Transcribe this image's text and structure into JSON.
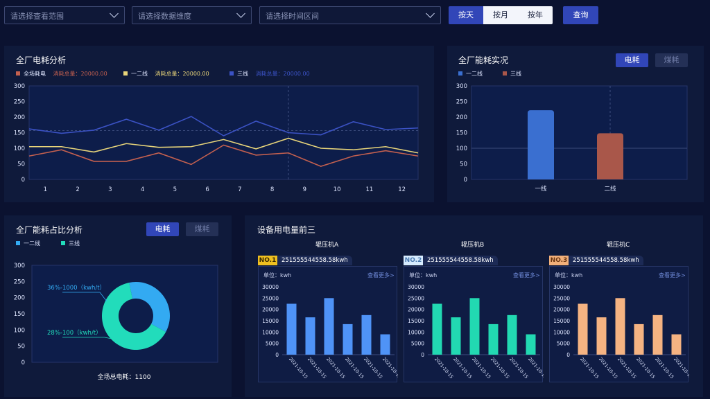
{
  "filters": {
    "scope_placeholder": "请选择查看范围",
    "dimension_placeholder": "请选择数据维度",
    "time_placeholder": "请选择时间区间",
    "period_buttons": [
      "按天",
      "按月",
      "按年"
    ],
    "query_label": "查询"
  },
  "toggles": {
    "power": "电耗",
    "coal": "煤耗"
  },
  "power_analysis": {
    "title": "全厂电耗分析",
    "legend": [
      {
        "name": "全场耗电",
        "total_label": "消耗总量：20000.00",
        "color": "#c4604f"
      },
      {
        "name": "一二线",
        "total_label": "消耗总量：20000.00",
        "color": "#e8d57a"
      },
      {
        "name": "三线",
        "total_label": "消耗总量：20000.00",
        "color": "#3b52c4"
      }
    ]
  },
  "energy_status": {
    "title": "全厂能耗实况",
    "legend": [
      {
        "name": "一二线",
        "color": "#3a6fd0"
      },
      {
        "name": "三线",
        "color": "#a9574a"
      }
    ]
  },
  "ratio_analysis": {
    "title": "全厂能耗占比分析",
    "legend": [
      {
        "name": "一二线",
        "color": "#33aaf2"
      },
      {
        "name": "三线",
        "color": "#22dcbb"
      }
    ],
    "total_label": "全场总电耗：1100"
  },
  "top_devices": {
    "title": "设备用电量前三",
    "unit_label": "单位：kwh",
    "more_label": "查看更多>",
    "devices": [
      {
        "name": "辊压机A",
        "rank": "NO.1",
        "serial": "251555544558.58kwh",
        "rank_bg": "#f0c020",
        "rank_color": "#3a2a00",
        "bar_color": "#4f93f7"
      },
      {
        "name": "辊压机B",
        "rank": "NO.2",
        "serial": "251555544558.58kwh",
        "rank_bg": "#d7ecff",
        "rank_color": "#4a7ab0",
        "bar_color": "#22d9b2"
      },
      {
        "name": "辊压机C",
        "rank": "NO.3",
        "serial": "251555544558.58kwh",
        "rank_bg": "#f2b07a",
        "rank_color": "#6a3510",
        "bar_color": "#f5b382"
      }
    ]
  },
  "chart_data": [
    {
      "type": "line",
      "title": "全厂电耗分析",
      "x": [
        1,
        2,
        3,
        4,
        5,
        6,
        7,
        8,
        9,
        10,
        11,
        12
      ],
      "ylim": [
        0,
        300
      ],
      "yticks": [
        0,
        50,
        100,
        150,
        200,
        250,
        300
      ],
      "grid": false,
      "series": [
        {
          "name": "全场耗电",
          "color": "#c4604f",
          "values": [
            75,
            95,
            58,
            58,
            85,
            48,
            110,
            78,
            85,
            42,
            75,
            92,
            75
          ]
        },
        {
          "name": "一二线",
          "color": "#e8d57a",
          "values": [
            105,
            105,
            88,
            115,
            103,
            105,
            128,
            98,
            132,
            100,
            95,
            105,
            85
          ]
        },
        {
          "name": "三线",
          "color": "#3b52c4",
          "values": [
            162,
            148,
            158,
            193,
            158,
            202,
            140,
            187,
            150,
            143,
            185,
            160,
            165
          ]
        }
      ]
    },
    {
      "type": "bar",
      "title": "全厂能耗实况",
      "categories": [
        "一线",
        "二线"
      ],
      "values": [
        222,
        148
      ],
      "colors": [
        "#3a6fd0",
        "#a9574a"
      ],
      "ylim": [
        0,
        300
      ],
      "yticks": [
        0,
        50,
        100,
        150,
        200,
        250,
        300
      ]
    },
    {
      "type": "pie",
      "title": "全厂能耗占比分析",
      "slices": [
        {
          "label": "36%-1000（kwh/t）",
          "value": 36,
          "color": "#33aaf2"
        },
        {
          "label": "28%-100（kwh/t）",
          "value": 64,
          "color": "#22dcbb"
        }
      ],
      "yticks": [
        0,
        50,
        100,
        150,
        200,
        250,
        300
      ]
    },
    {
      "type": "bar",
      "title": "辊压机A",
      "categories": [
        "2021-10-15",
        "2021-10-15",
        "2021-10-15",
        "2021-10-15",
        "2021-10-15",
        "2021-10-15"
      ],
      "values": [
        22500,
        16500,
        25000,
        13500,
        17500,
        9000
      ],
      "ylim": [
        0,
        30000
      ],
      "yticks": [
        0,
        5000,
        10000,
        15000,
        20000,
        25000,
        30000
      ]
    },
    {
      "type": "bar",
      "title": "辊压机B",
      "categories": [
        "2021-10-15",
        "2021-10-15",
        "2021-10-15",
        "2021-10-15",
        "2021-10-15",
        "2021-10-15"
      ],
      "values": [
        22500,
        16500,
        25000,
        13500,
        17500,
        9000
      ],
      "ylim": [
        0,
        30000
      ],
      "yticks": [
        0,
        5000,
        10000,
        15000,
        20000,
        25000,
        30000
      ]
    },
    {
      "type": "bar",
      "title": "辊压机C",
      "categories": [
        "2021-10-15",
        "2021-10-15",
        "2021-10-15",
        "2021-10-15",
        "2021-10-15",
        "2021-10-15"
      ],
      "values": [
        22500,
        16500,
        25000,
        13500,
        17500,
        9000
      ],
      "ylim": [
        0,
        30000
      ],
      "yticks": [
        0,
        5000,
        10000,
        15000,
        20000,
        25000,
        30000
      ]
    }
  ]
}
